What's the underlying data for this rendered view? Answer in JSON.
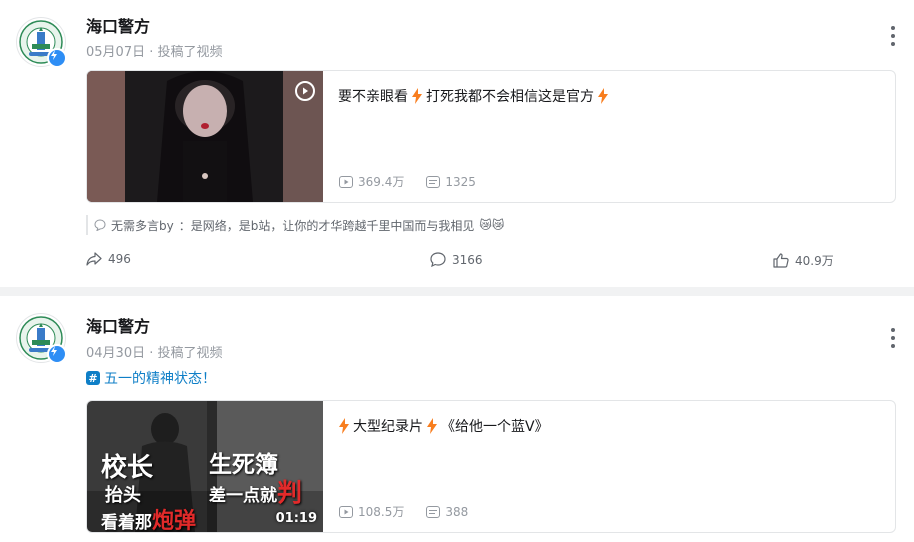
{
  "colors": {
    "accent_blue": "#0f7fc7",
    "lightning": "#f87e1f",
    "muted": "#9499a0",
    "red_text": "#e22a2a"
  },
  "posts": [
    {
      "author": "海口警方",
      "meta": "05月07日 · 投稿了视频",
      "video": {
        "title_parts": [
          "要不亲眼看",
          "打死我都不会相信这是官方"
        ],
        "views": "369.4万",
        "danmaku": "1325"
      },
      "comment": {
        "user": "无需多言by",
        "text": "：是网络，是b站，让你的才华跨越千里中国而与我相见",
        "emoji": "😿😿"
      },
      "actions": {
        "share": "496",
        "comments": "3166",
        "likes": "40.9万"
      }
    },
    {
      "author": "海口警方",
      "meta": "04月30日 · 投稿了视频",
      "topic": "五一的精神状态！",
      "video": {
        "title_parts": [
          "大型纪录片",
          "《给他一个蓝V》"
        ],
        "views": "108.5万",
        "danmaku": "388",
        "duration": "01:19",
        "overlay": {
          "line1": "校长",
          "line2": "抬头",
          "line3a": "看着那",
          "line3b": "炮弹",
          "right1": "生死簿",
          "right2a": "差一点就",
          "right2b": "判"
        }
      }
    }
  ],
  "icons": {
    "verify": "lightning-verify-icon",
    "more": "more-vertical-icon",
    "play_count": "play-count-icon",
    "danmaku": "danmaku-icon",
    "share": "share-icon",
    "comment": "comment-icon",
    "like": "like-icon",
    "bolt": "lightning-bolt-icon",
    "replay": "replay-icon",
    "topic": "topic-hash-icon"
  }
}
